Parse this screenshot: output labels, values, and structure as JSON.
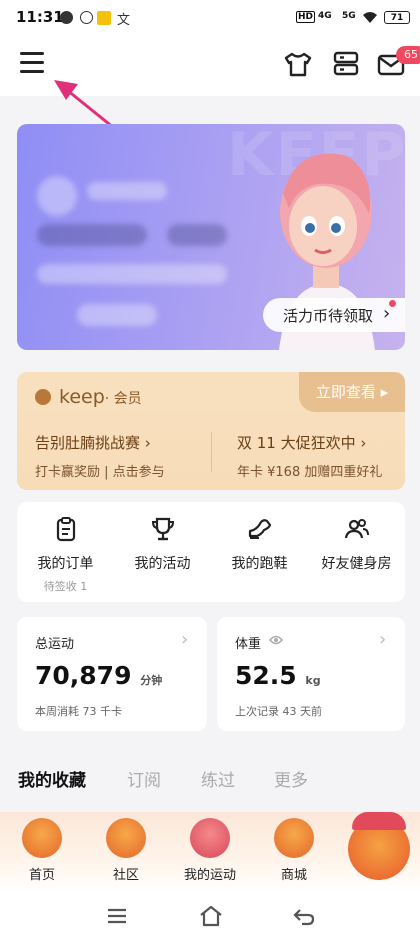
{
  "status_bar": {
    "time": "11:31",
    "network": [
      "4G",
      "5G"
    ],
    "hd": "HD",
    "battery": "71"
  },
  "header": {
    "mail_badge": "65",
    "icons": [
      "menu-icon",
      "tshirt-icon",
      "device-icon",
      "mail-icon"
    ]
  },
  "banner": {
    "button_label": "活力币待领取",
    "chevron": "›",
    "watermark": "KEEP"
  },
  "vip": {
    "brand": "keep",
    "brand_suffix": "· 会员",
    "cta": "立即查看 ▸",
    "promos": [
      {
        "title": "告别肚腩挑战赛 ›",
        "subtitle": "打卡赢奖励 | 点击参与"
      },
      {
        "title": "双 11 大促狂欢中 ›",
        "subtitle": "年卡 ¥168 加赠四重好礼"
      }
    ]
  },
  "quick_actions": [
    {
      "label": "我的订单",
      "sub": "待签收 1",
      "icon": "clipboard-icon"
    },
    {
      "label": "我的活动",
      "sub": "",
      "icon": "trophy-icon"
    },
    {
      "label": "我的跑鞋",
      "sub": "",
      "icon": "shoe-icon"
    },
    {
      "label": "好友健身房",
      "sub": "",
      "icon": "friends-icon"
    }
  ],
  "stats": {
    "exercise": {
      "title": "总运动",
      "value": "70,879",
      "unit": "分钟",
      "sub": "本周消耗 73 千卡"
    },
    "weight": {
      "title": "体重",
      "value": "52.5",
      "unit": "kg",
      "sub": "上次记录 43 天前"
    }
  },
  "tabs": [
    "我的收藏",
    "订阅",
    "练过",
    "更多"
  ],
  "bottom_tabs": [
    "首页",
    "社区",
    "我的运动",
    "商城"
  ],
  "colors": {
    "accent": "#f0485e",
    "banner": "#9c96f4",
    "vip": "#f8e0bf"
  }
}
